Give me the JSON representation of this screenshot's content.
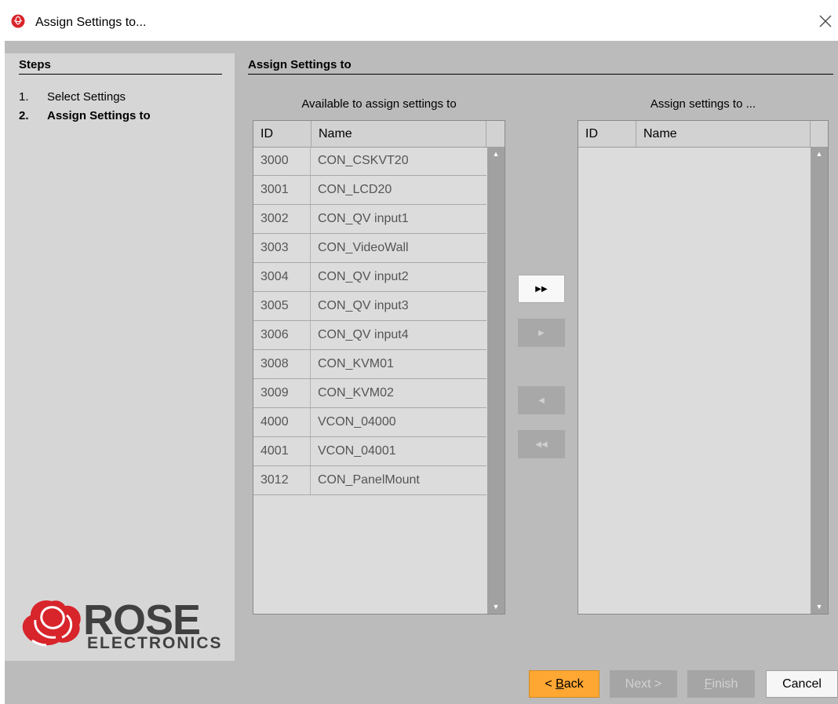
{
  "window": {
    "title": "Assign Settings to...",
    "close_icon": "close-icon"
  },
  "steps_panel": {
    "title": "Steps",
    "items": [
      {
        "num": "1.",
        "label": "Select Settings",
        "active": false
      },
      {
        "num": "2.",
        "label": "Assign Settings to",
        "active": true
      }
    ]
  },
  "main": {
    "title": "Assign Settings to",
    "available": {
      "caption": "Available to assign settings to",
      "columns": [
        "ID",
        "Name"
      ],
      "rows": [
        {
          "id": "3000",
          "name": "CON_CSKVT20"
        },
        {
          "id": "3001",
          "name": "CON_LCD20"
        },
        {
          "id": "3002",
          "name": "CON_QV input1"
        },
        {
          "id": "3003",
          "name": "CON_VideoWall"
        },
        {
          "id": "3004",
          "name": "CON_QV input2"
        },
        {
          "id": "3005",
          "name": "CON_QV input3"
        },
        {
          "id": "3006",
          "name": "CON_QV input4"
        },
        {
          "id": "3008",
          "name": "CON_KVM01"
        },
        {
          "id": "3009",
          "name": "CON_KVM02"
        },
        {
          "id": "4000",
          "name": "VCON_04000"
        },
        {
          "id": "4001",
          "name": "VCON_04001"
        },
        {
          "id": "3012",
          "name": "CON_PanelMount"
        }
      ]
    },
    "assigned": {
      "caption": "Assign settings to ...",
      "columns": [
        "ID",
        "Name"
      ],
      "rows": []
    },
    "transfer_buttons": [
      {
        "name": "move-all-right-button",
        "glyph": "▶▶",
        "enabled": true
      },
      {
        "name": "move-right-button",
        "glyph": "▶",
        "enabled": false
      },
      {
        "name": "move-left-button",
        "glyph": "◀",
        "enabled": false
      },
      {
        "name": "move-all-left-button",
        "glyph": "◀◀",
        "enabled": false
      }
    ]
  },
  "footer": {
    "back": {
      "prefix": "< ",
      "mnemonic": "B",
      "rest": "ack"
    },
    "next": "Next >",
    "finish": {
      "mnemonic": "F",
      "rest": "inish"
    },
    "cancel": "Cancel"
  },
  "logo": {
    "word": "ROSE",
    "sub": "ELECTRONICS"
  },
  "colors": {
    "accent": "#ffa733",
    "panel": "#d6d6d6",
    "body": "#bbbbbb",
    "logo_red": "#d8242b"
  }
}
